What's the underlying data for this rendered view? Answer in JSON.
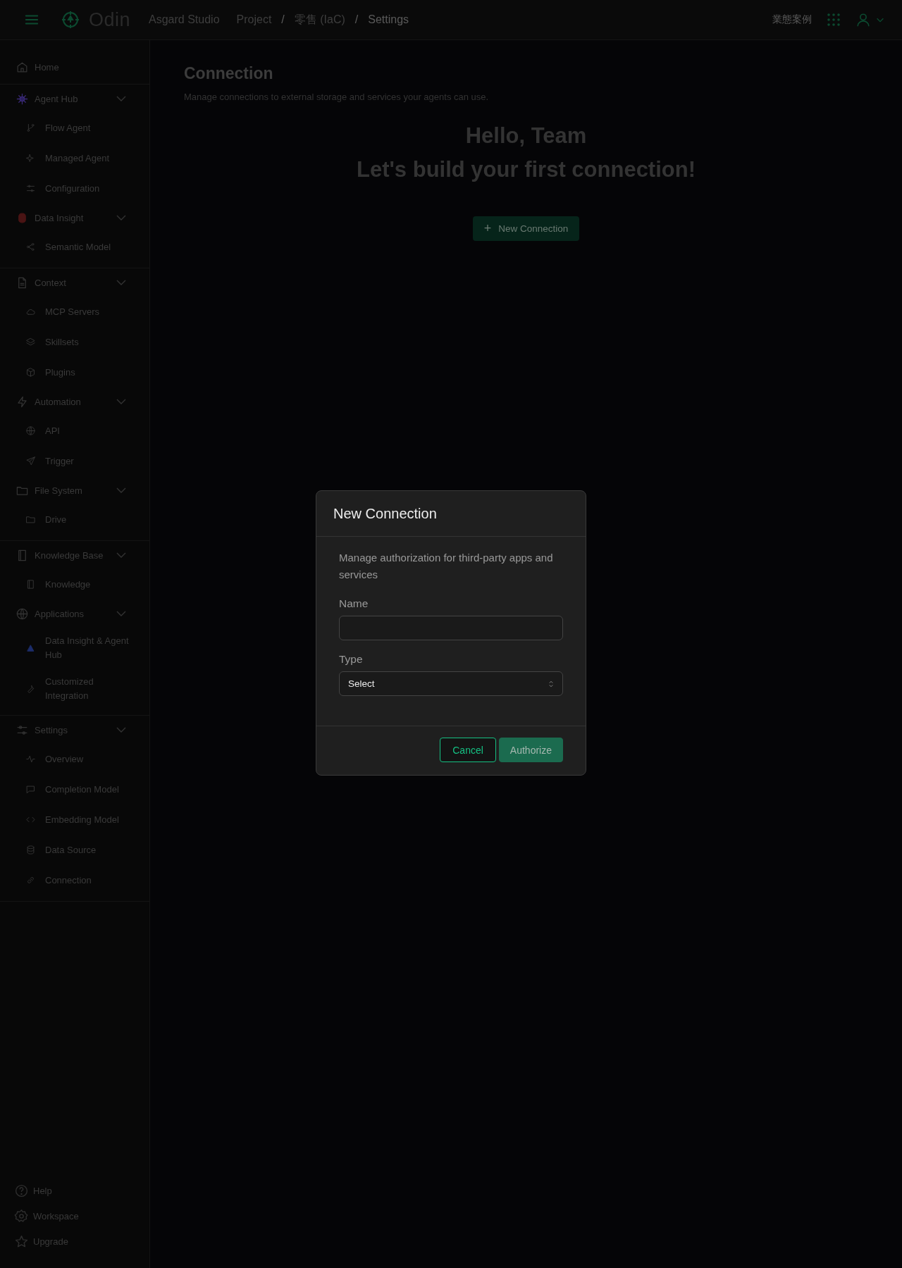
{
  "header": {
    "logo": "Odin",
    "workspace": "Asgard Studio",
    "breadcrumb": [
      "Project",
      "零售 (IaC)",
      "Settings"
    ],
    "separator": "/",
    "right_label": "業態案例"
  },
  "sidebar": {
    "sections": [
      {
        "items": [
          {
            "kind": "link",
            "label": "Home"
          }
        ]
      },
      {
        "items": [
          {
            "kind": "group",
            "label": "Agent Hub",
            "expanded": true,
            "children": [
              {
                "label": "Flow Agent"
              },
              {
                "label": "Managed Agent"
              },
              {
                "label": "Configuration"
              }
            ]
          },
          {
            "kind": "group",
            "label": "Data Insight",
            "expanded": true,
            "children": [
              {
                "label": "Semantic Model"
              }
            ]
          }
        ]
      },
      {
        "items": [
          {
            "kind": "group",
            "label": "Context",
            "expanded": true,
            "children": [
              {
                "label": "MCP Servers"
              },
              {
                "label": "Skillsets"
              },
              {
                "label": "Plugins"
              }
            ]
          },
          {
            "kind": "group",
            "label": "Automation",
            "expanded": true,
            "children": [
              {
                "label": "API"
              },
              {
                "label": "Trigger"
              }
            ]
          },
          {
            "kind": "group",
            "label": "File System",
            "expanded": true,
            "children": [
              {
                "label": "Drive"
              }
            ]
          }
        ]
      },
      {
        "items": [
          {
            "kind": "group",
            "label": "Knowledge Base",
            "expanded": true,
            "children": [
              {
                "label": "Knowledge"
              }
            ]
          },
          {
            "kind": "group",
            "label": "Applications",
            "expanded": true,
            "children": [
              {
                "label": "Data Insight & Agent Hub"
              },
              {
                "label": "Customized Integration"
              }
            ]
          }
        ]
      },
      {
        "items": [
          {
            "kind": "group",
            "label": "Settings",
            "expanded": true,
            "children": [
              {
                "label": "Overview"
              },
              {
                "label": "Completion Model"
              },
              {
                "label": "Embedding Model"
              },
              {
                "label": "Data Source"
              },
              {
                "label": "Connection"
              }
            ]
          }
        ]
      }
    ],
    "footer": [
      {
        "label": "Help"
      },
      {
        "label": "Workspace"
      },
      {
        "label": "Upgrade"
      }
    ]
  },
  "page": {
    "title": "Connection",
    "subtitle": "Manage connections to external storage and services your agents can use.",
    "greeting": "Hello, Team",
    "headline": "Let's build your first connection!",
    "action": {
      "icon": "+",
      "label": "New Connection"
    }
  },
  "dialog": {
    "title": "New Connection",
    "description": "Manage authorization for third-party apps and services",
    "fields": [
      {
        "kind": "text",
        "label": "Name"
      },
      {
        "kind": "select",
        "label": "Type",
        "value": "Select"
      }
    ],
    "buttons": [
      {
        "kind": "secondary",
        "label": "Cancel"
      },
      {
        "kind": "primary",
        "label": "Authorize"
      }
    ]
  }
}
